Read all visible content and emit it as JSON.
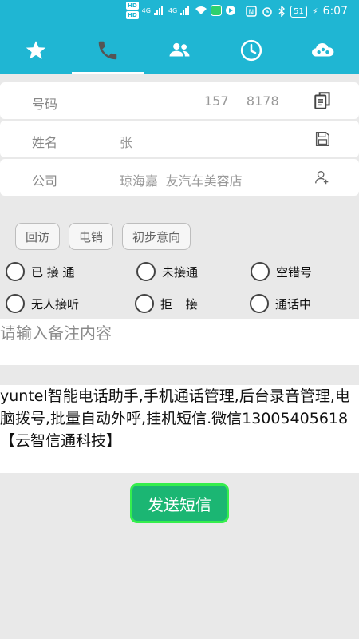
{
  "status_bar": {
    "hd1": "HD",
    "hd2": "HD",
    "net1": "4G",
    "net2": "4G",
    "battery": "51",
    "time": "6:07"
  },
  "tabs": [
    {
      "icon": "star-icon",
      "active": false
    },
    {
      "icon": "phone-icon",
      "active": true
    },
    {
      "icon": "contacts-icon",
      "active": false
    },
    {
      "icon": "clock-icon",
      "active": false
    },
    {
      "icon": "cloud-icon",
      "active": false
    }
  ],
  "fields": {
    "phone_label": "号码",
    "phone_value": "157       8178",
    "name_label": "姓名",
    "name_value": "张",
    "company_label": "公司",
    "company_value": "琼海嘉   友汽车美容店"
  },
  "chips": [
    "回访",
    "电销",
    "初步意向"
  ],
  "call_status": {
    "connected": "已 接 通",
    "not_connected": "未接通",
    "wrong_number": "空错号",
    "no_answer": "无人接听",
    "rejected": "拒 接",
    "busy": "通话中"
  },
  "notes": {
    "placeholder": "请输入备注内容"
  },
  "sms": {
    "text": "yuntel智能电话助手,手机通话管理,后台录音管理,电脑拨号,批量自动外呼,挂机短信.微信13005405618【云智信通科技】",
    "send_label": "发送短信"
  },
  "colors": {
    "primary": "#1fb6d3",
    "send_button": "#1bb673",
    "send_border": "#35ee4d"
  }
}
